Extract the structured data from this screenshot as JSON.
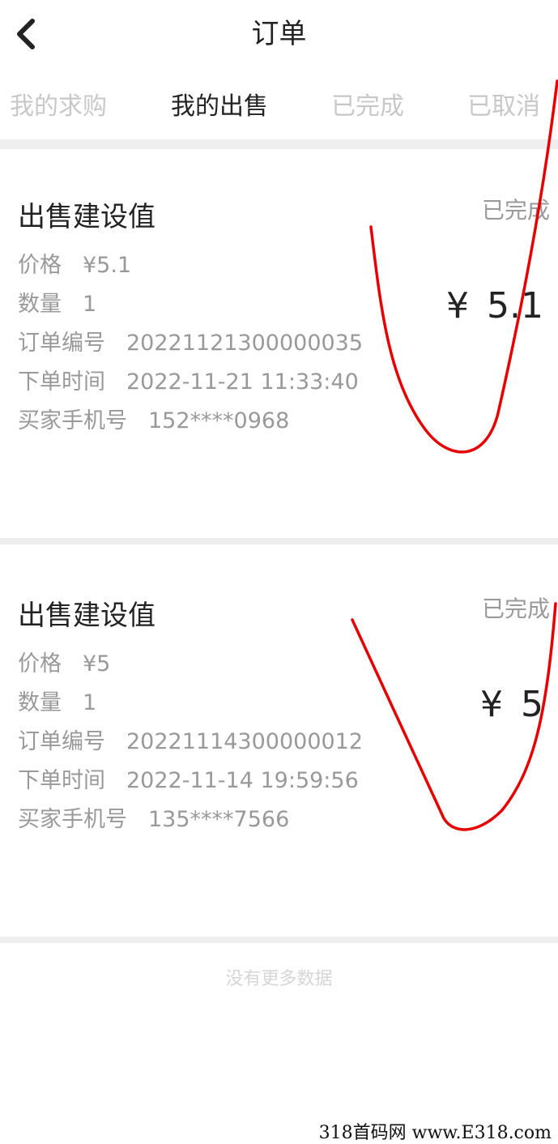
{
  "header": {
    "title": "订单"
  },
  "tabs": [
    {
      "label": "我的求购"
    },
    {
      "label": "我的出售"
    },
    {
      "label": "已完成"
    },
    {
      "label": "已取消"
    }
  ],
  "orders": [
    {
      "title": "出售建设值",
      "status": "已完成",
      "amount_symbol": "¥",
      "amount": "5.1",
      "fields": [
        {
          "label": "价格",
          "value": "¥5.1"
        },
        {
          "label": "数量",
          "value": "1"
        },
        {
          "label": "订单编号",
          "value": "20221121300000035"
        },
        {
          "label": "下单时间",
          "value": "2022-11-21  11:33:40"
        },
        {
          "label": "买家手机号",
          "value": "152****0968"
        }
      ]
    },
    {
      "title": "出售建设值",
      "status": "已完成",
      "amount_symbol": "¥",
      "amount": "5",
      "fields": [
        {
          "label": "价格",
          "value": "¥5"
        },
        {
          "label": "数量",
          "value": "1"
        },
        {
          "label": "订单编号",
          "value": "20221114300000012"
        },
        {
          "label": "下单时间",
          "value": "2022-11-14  19:59:56"
        },
        {
          "label": "买家手机号",
          "value": "135****7566"
        }
      ]
    }
  ],
  "footer": {
    "no_more": "没有更多数据"
  },
  "watermark": "318首码网  www.E318.com",
  "colors": {
    "annotation": "#e60000",
    "active_tab": "#222222",
    "inactive_tab": "#c8c8c8"
  }
}
